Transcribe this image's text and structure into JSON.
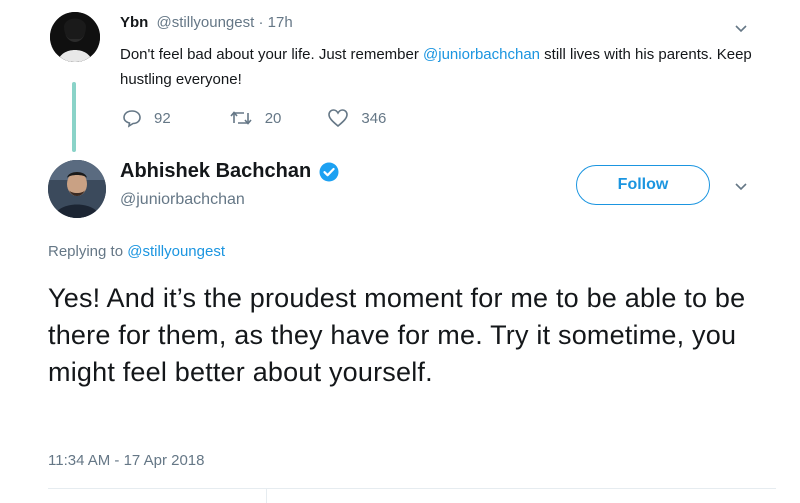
{
  "reply": {
    "name": "Ybn",
    "handle": "@stillyoungest",
    "separator": "·",
    "time": "17h",
    "text_before": "Don't feel bad about your life. Just remember ",
    "mention": "@juniorbachchan",
    "text_after": " still lives with his parents. Keep hustling everyone!",
    "actions": {
      "replies": "92",
      "retweets": "20",
      "likes": "346"
    }
  },
  "tweet": {
    "author_name": "Abhishek Bachchan",
    "author_handle": "@juniorbachchan",
    "follow_label": "Follow",
    "replying_prefix": "Replying to ",
    "replying_handle": "@stillyoungest",
    "body": "Yes! And it’s the proudest moment for me to be able to be there for them, as they have for me. Try it sometime, you might feel better about yourself.",
    "timestamp": "11:34 AM - 17 Apr 2018"
  },
  "colors": {
    "accent": "#1b95e0",
    "muted": "#657786",
    "thread_line": "#8ad3c8"
  },
  "icons": {
    "reply": "reply-icon",
    "retweet": "retweet-icon",
    "like": "heart-icon",
    "verified": "verified-badge-icon",
    "caret": "chevron-down-icon"
  }
}
